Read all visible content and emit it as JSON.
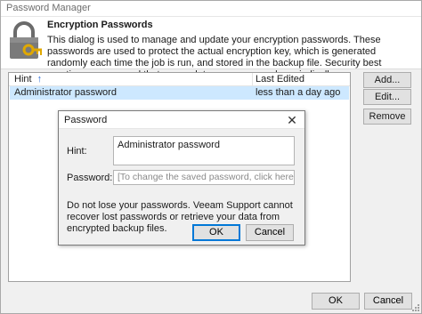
{
  "window": {
    "title": "Password Manager"
  },
  "header": {
    "title": "Encryption Passwords",
    "description": "This dialog is used to manage and update your encryption passwords. These passwords are used to protect the actual encryption key, which is generated randomly each time the job is run, and stored in the backup file. Security best practices recommend that you update your passwords periodically."
  },
  "list": {
    "columns": [
      "Hint",
      "Last Edited"
    ],
    "sort_icon": "sort-ascending-arrow",
    "rows": [
      {
        "hint": "Administrator password",
        "last_edited": "less than a day ago"
      }
    ]
  },
  "side_buttons": {
    "add": "Add...",
    "edit": "Edit...",
    "remove": "Remove"
  },
  "bottom_buttons": {
    "ok": "OK",
    "cancel": "Cancel"
  },
  "dialog": {
    "title": "Password",
    "close_icon": "close-icon",
    "hint_label": "Hint:",
    "hint_value": "Administrator password",
    "password_label": "Password:",
    "password_placeholder": "[To change the saved password, click here]",
    "warning": "Do not lose your passwords. Veeam Support cannot recover lost passwords or retrieve your data from encrypted backup files.",
    "ok": "OK",
    "cancel": "Cancel"
  },
  "colors": {
    "accent": "#0078d7",
    "selection": "#cde8ff",
    "key_gold": "#e0a800"
  }
}
